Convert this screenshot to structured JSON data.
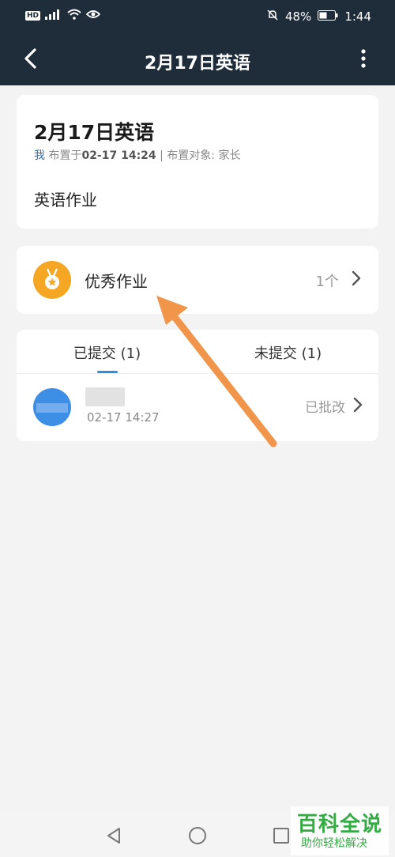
{
  "status_bar": {
    "hd_label": "HD",
    "battery_percent": "48%",
    "time": "1:44"
  },
  "nav": {
    "title": "2月17日英语"
  },
  "assignment": {
    "title": "2月17日英语",
    "author": "我",
    "assigned_at_prefix": "布置于",
    "assigned_at": "02-17 14:24",
    "separator": "|",
    "target_label": "布置对象:",
    "target": "家长",
    "content": "英语作业"
  },
  "excellent": {
    "label": "优秀作业",
    "count": "1个"
  },
  "tabs": [
    {
      "label": "已提交 (1)",
      "active": true
    },
    {
      "label": "未提交 (1)",
      "active": false
    }
  ],
  "submissions": [
    {
      "time": "02-17 14:27",
      "status": "已批改"
    }
  ],
  "watermark": {
    "title": "百科全说",
    "subtitle": "助你轻松解决"
  },
  "colors": {
    "header_bg": "#1f2c3a",
    "accent_blue": "#2f8fe0",
    "medal_orange": "#f5a623",
    "annotation_arrow": "#f0954a",
    "watermark_green": "#2aa83a"
  }
}
